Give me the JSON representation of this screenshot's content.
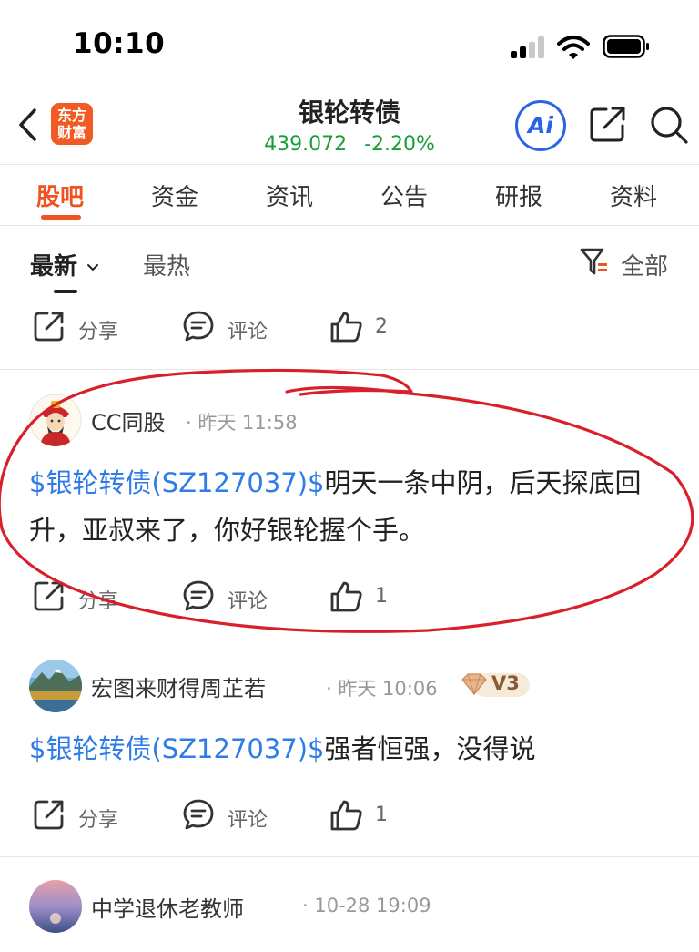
{
  "status_bar": {
    "time": "10:10"
  },
  "header": {
    "logo_line1": "东方",
    "logo_line2": "财富",
    "title": "银轮转债",
    "price": "439.072",
    "change": "-2.20%",
    "ai_label": "Ai",
    "quote_color": "#1a9e3a",
    "accent_color": "#f0531f"
  },
  "tabs": [
    {
      "label": "股吧",
      "active": true
    },
    {
      "label": "资金"
    },
    {
      "label": "资讯"
    },
    {
      "label": "公告"
    },
    {
      "label": "研报"
    },
    {
      "label": "资料"
    }
  ],
  "sort": {
    "latest": "最新",
    "hot": "最热",
    "filter": "全部"
  },
  "actions": {
    "share": "分享",
    "comment": "评论"
  },
  "top_row": {
    "likes": "2"
  },
  "posts": [
    {
      "author": "CC同股",
      "time": "昨天 11:58",
      "tag": "$银轮转债(SZ127037)$",
      "text": "明天一条中阴，后天探底回升，亚叔来了，你好银轮握个手。",
      "likes": "1"
    },
    {
      "author": "宏图来财得周芷若",
      "time": "昨天 10:06",
      "badge": "V3",
      "tag": "$银轮转债(SZ127037)$",
      "text": "强者恒强，没得说",
      "likes": "1"
    },
    {
      "author": "中学退休老教师",
      "time": "10-28 19:09"
    }
  ]
}
